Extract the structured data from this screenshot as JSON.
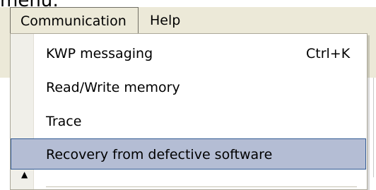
{
  "caption": {
    "text": "menu:"
  },
  "menubar": {
    "items": [
      {
        "label": "Communication"
      },
      {
        "label": "Help"
      }
    ]
  },
  "dropdown": {
    "items": [
      {
        "label": "KWP messaging",
        "shortcut": "Ctrl+K"
      },
      {
        "label": "Read/Write memory"
      },
      {
        "label": "Trace"
      },
      {
        "label": "Recovery from defective software",
        "highlighted": true
      }
    ]
  },
  "colors": {
    "menubar_bg": "#ece9d8",
    "highlight_bg": "#b4bdd4",
    "highlight_border": "#315a94"
  }
}
